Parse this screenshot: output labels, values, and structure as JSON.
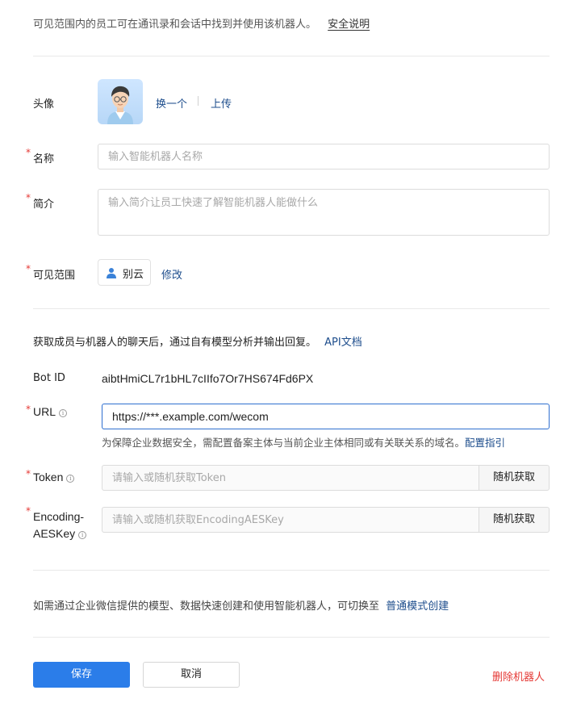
{
  "notice": {
    "text": "可见范围内的员工可在通讯录和会话中找到并使用该机器人。",
    "link": "安全说明"
  },
  "avatar": {
    "label": "头像",
    "change": "换一个",
    "upload": "上传",
    "icon": "person-avatar-icon"
  },
  "name": {
    "label": "名称",
    "placeholder": "输入智能机器人名称"
  },
  "intro": {
    "label": "简介",
    "placeholder": "输入简介让员工快速了解智能机器人能做什么"
  },
  "scope": {
    "label": "可见范围",
    "member": "别云",
    "edit": "修改"
  },
  "api": {
    "description": "获取成员与机器人的聊天后，通过自有模型分析并输出回复。",
    "doc_link": "API文档"
  },
  "bot_id": {
    "label": "Bot ID",
    "value": "aibtHmiCL7r1bHL7cIIfo7Or7HS674Fd6PX"
  },
  "url": {
    "label": "URL",
    "value": "https://***.example.com/wecom",
    "hint": "为保障企业数据安全，需配置备案主体与当前企业主体相同或有关联关系的域名。",
    "hint_link": "配置指引"
  },
  "token": {
    "label": "Token",
    "placeholder": "请输入或随机获取Token",
    "button": "随机获取"
  },
  "aes": {
    "label_line1": "Encoding-",
    "label_line2": "AESKey",
    "placeholder": "请输入或随机获取EncodingAESKey",
    "button": "随机获取"
  },
  "switch": {
    "text": "如需通过企业微信提供的模型、数据快速创建和使用智能机器人，可切换至",
    "link": "普通模式创建"
  },
  "footer": {
    "save": "保存",
    "cancel": "取消",
    "delete": "删除机器人"
  },
  "required_mark": "*",
  "info_mark": "i",
  "colors": {
    "primary": "#2b7de9",
    "link": "#1d4d8c",
    "danger": "#e53935",
    "focus": "#2f6fd0"
  }
}
